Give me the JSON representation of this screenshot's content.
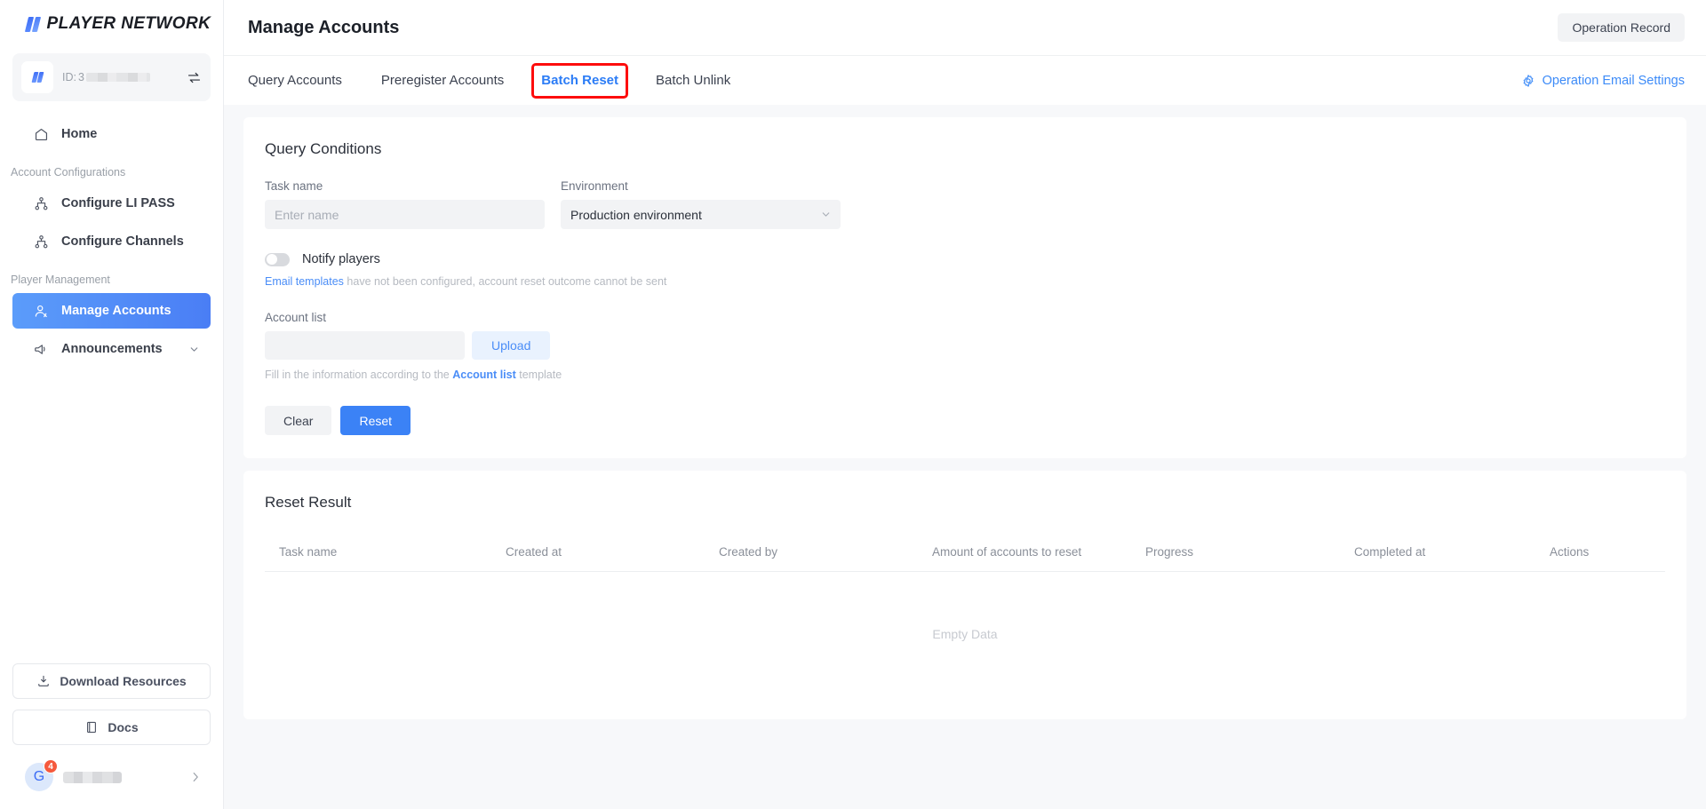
{
  "brand": {
    "name": "PLAYER NETWORK"
  },
  "account_switcher": {
    "id_label": "ID:",
    "id_value_prefix": "3",
    "swap_icon": "swap-icon"
  },
  "sidebar": {
    "items": [
      {
        "label": "Home",
        "icon": "home-icon",
        "type": "item",
        "active": false
      },
      {
        "label": "Account Configurations",
        "type": "group"
      },
      {
        "label": "Configure LI PASS",
        "icon": "node-tree-icon",
        "type": "item",
        "active": false
      },
      {
        "label": "Configure Channels",
        "icon": "node-tree-icon",
        "type": "item",
        "active": false
      },
      {
        "label": "Player Management",
        "type": "group"
      },
      {
        "label": "Manage Accounts",
        "icon": "user-gear-icon",
        "type": "item",
        "active": true
      },
      {
        "label": "Announcements",
        "icon": "megaphone-icon",
        "type": "item",
        "active": false,
        "expandable": true
      }
    ],
    "download_resources": "Download Resources",
    "docs": "Docs",
    "user": {
      "avatar_letter": "G",
      "badge_count": "4"
    }
  },
  "header": {
    "title": "Manage Accounts",
    "operation_record": "Operation Record"
  },
  "tabbar": {
    "tabs": [
      {
        "label": "Query Accounts",
        "active": false,
        "highlighted": false
      },
      {
        "label": "Preregister Accounts",
        "active": false,
        "highlighted": false
      },
      {
        "label": "Batch Reset",
        "active": true,
        "highlighted": true
      },
      {
        "label": "Batch Unlink",
        "active": false,
        "highlighted": false
      }
    ],
    "email_settings": "Operation Email Settings",
    "highlight_color": "#fd0d0d",
    "active_color": "#2b7cf6"
  },
  "query_conditions": {
    "title": "Query Conditions",
    "task_name": {
      "label": "Task name",
      "placeholder": "Enter name",
      "value": ""
    },
    "environment": {
      "label": "Environment",
      "value": "Production environment"
    },
    "notify": {
      "label": "Notify players",
      "enabled": false,
      "hint_link": "Email templates",
      "hint_rest": " have not been configured, account reset outcome cannot be sent"
    },
    "account_list": {
      "label": "Account list",
      "file_value": "",
      "upload_label": "Upload",
      "hint_prefix": "Fill in the information according to the ",
      "hint_link": "Account list",
      "hint_suffix": " template"
    },
    "buttons": {
      "clear": "Clear",
      "reset": "Reset"
    }
  },
  "reset_result": {
    "title": "Reset Result",
    "columns": [
      "Task name",
      "Created at",
      "Created by",
      "Amount of accounts to reset",
      "Progress",
      "Completed at",
      "Actions"
    ],
    "rows": [],
    "empty_text": "Empty Data"
  }
}
